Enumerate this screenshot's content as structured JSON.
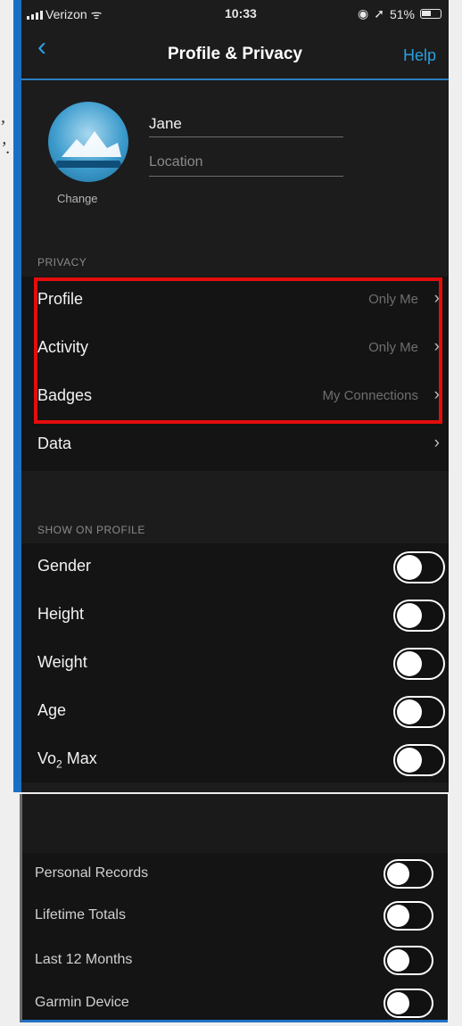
{
  "bg_fragments": [
    ",",
    "’."
  ],
  "status_bar": {
    "carrier": "Verizon",
    "time": "10:33",
    "battery": "51%"
  },
  "header": {
    "title": "Profile & Privacy",
    "help": "Help",
    "back_icon": "chevron-left-icon"
  },
  "profile": {
    "name": "Jane",
    "location_placeholder": "Location",
    "change_label": "Change"
  },
  "privacy": {
    "section_label": "PRIVACY",
    "items": [
      {
        "label": "Profile",
        "value": "Only Me"
      },
      {
        "label": "Activity",
        "value": "Only Me"
      },
      {
        "label": "Badges",
        "value": "My Connections"
      },
      {
        "label": "Data",
        "value": ""
      }
    ]
  },
  "show_on_profile": {
    "section_label": "SHOW ON PROFILE",
    "items": [
      {
        "label": "Gender",
        "on": false
      },
      {
        "label": "Height",
        "on": false
      },
      {
        "label": "Weight",
        "on": false
      },
      {
        "label": "Age",
        "on": false
      },
      {
        "label_main": "Vo",
        "label_sub": "2",
        "label_rest": " Max",
        "on": false
      }
    ]
  },
  "more_items": [
    {
      "label": "Personal Records",
      "on": false
    },
    {
      "label": "Lifetime Totals",
      "on": false
    },
    {
      "label": "Last 12 Months",
      "on": false
    },
    {
      "label": "Garmin Device",
      "on": false
    }
  ],
  "colors": {
    "accent": "#2a9fe0",
    "highlight": "#e40d0d",
    "background": "#1c1c1c"
  }
}
